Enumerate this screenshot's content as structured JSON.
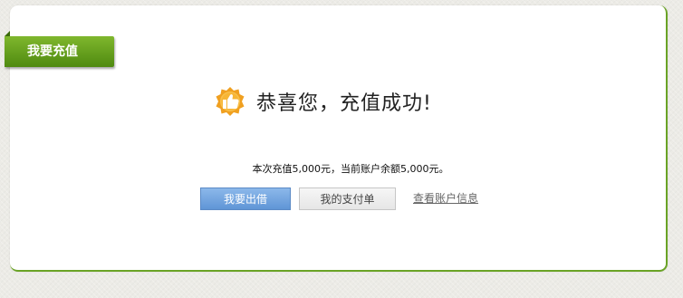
{
  "section_tab": {
    "label": "我要充值"
  },
  "result": {
    "icon": "thumbs-up-badge-icon",
    "message": "恭喜您，充值成功!",
    "summary": "本次充值5,000元，当前账户余额5,000元。"
  },
  "actions": {
    "lend_button": "我要出借",
    "payment_orders_button": "我的支付单",
    "view_account_link": "查看账户信息"
  },
  "colors": {
    "accent_green": "#6aa326",
    "primary_button_blue": "#6a9fdc",
    "badge_orange": "#f5a21e"
  }
}
